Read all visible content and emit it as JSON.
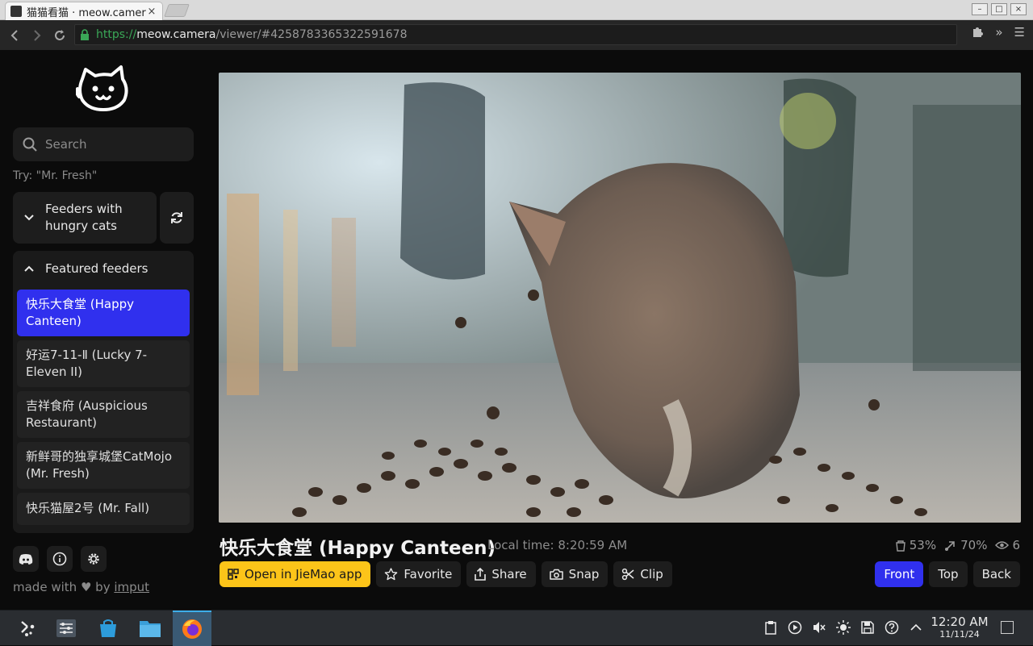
{
  "browser": {
    "tab_title": "猫猫看猫 · meow.camera",
    "tab_close": "×",
    "url_scheme": "https://",
    "url_host": "meow.camera",
    "url_path": "/viewer/#4258783365322591678"
  },
  "sidebar": {
    "search_placeholder": "Search",
    "hint": "Try: \"Mr. Fresh\"",
    "group_label": "Feeders with hungry cats",
    "featured_label": "Featured feeders",
    "feeders": [
      "快乐大食堂 (Happy Canteen)",
      "好运7-11-Ⅱ (Lucky 7-Eleven II)",
      "吉祥食府 (Auspicious Restaurant)",
      "新鲜哥的独享城堡CatMojo (Mr. Fresh)",
      "快乐猫屋2号 (Mr. Fall)"
    ],
    "made_with": "made with",
    "heart": "♥",
    "by": "by",
    "author": "imput"
  },
  "viewer": {
    "title": "快乐大食堂 (Happy Canteen)",
    "local_time": "Local time: 8:20:59 AM",
    "stats": {
      "food": "53%",
      "signal": "70%",
      "viewers": "6"
    },
    "actions": {
      "open_app": "Open in JieMao app",
      "favorite": "Favorite",
      "share": "Share",
      "snap": "Snap",
      "clip": "Clip"
    },
    "views": {
      "front": "Front",
      "top": "Top",
      "back": "Back"
    },
    "active_view": "Front"
  },
  "taskbar": {
    "time": "12:20 AM",
    "date": "11/11/24"
  },
  "colors": {
    "accent": "#3030ee",
    "primary_button": "#fcc419",
    "background": "#0b0b0b",
    "panel": "#1d1d1d"
  }
}
